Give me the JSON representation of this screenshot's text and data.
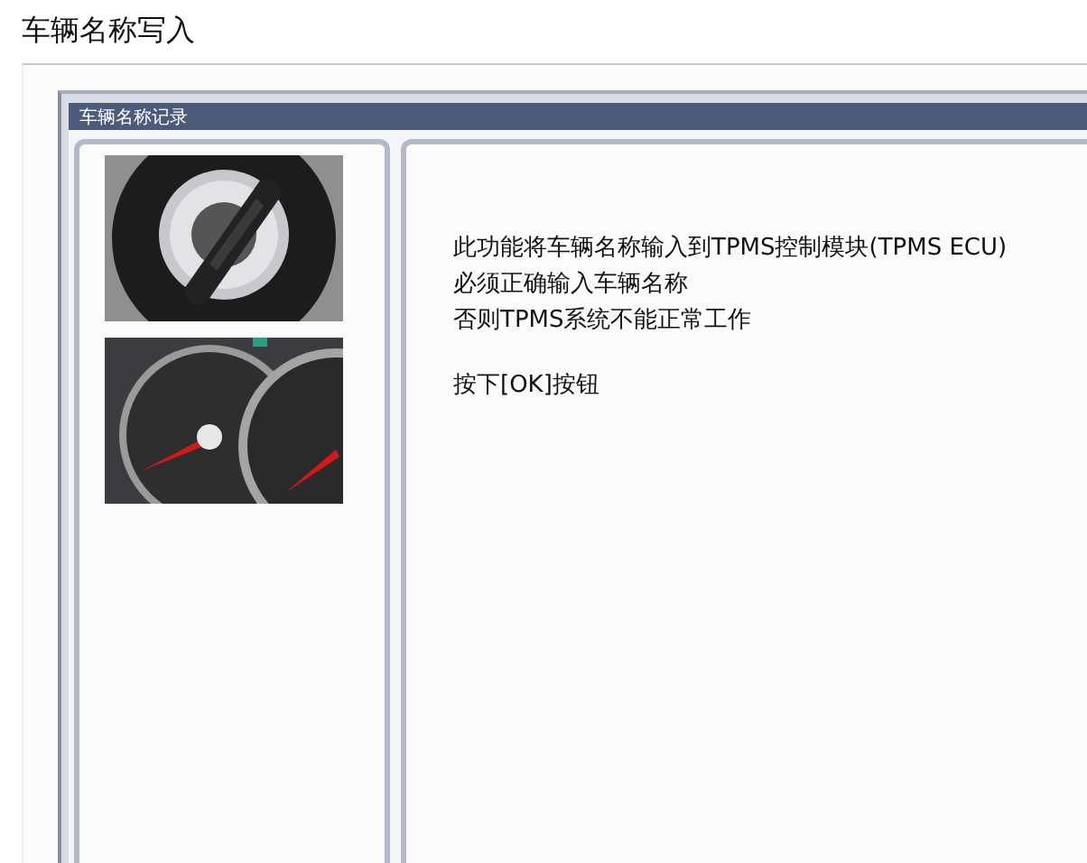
{
  "page_title": "车辆名称写入",
  "window": {
    "title": "车辆名称记录"
  },
  "images": [
    {
      "kind": "picture"
    },
    {
      "kind": "picture"
    }
  ],
  "message": [
    [
      "此功能将车辆名称输入到TPMS控制模块(TPMS ECU)",
      "必须正确输入车辆名称",
      "否则TPMS系统不能正常工作"
    ],
    [
      "按下[OK]按钮"
    ]
  ]
}
